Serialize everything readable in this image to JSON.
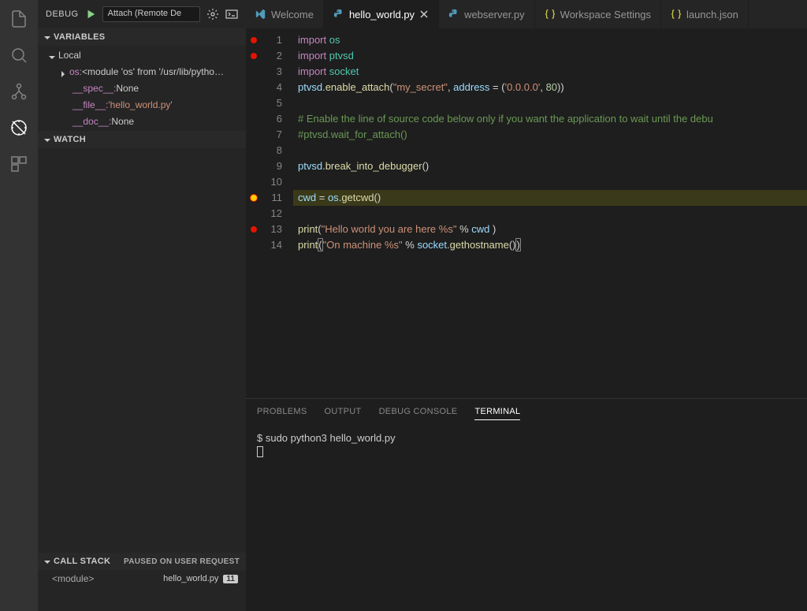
{
  "activity": {
    "icons": [
      "files",
      "search",
      "git",
      "debug",
      "extensions"
    ]
  },
  "debug": {
    "label": "DEBUG",
    "config": "Attach (Remote De",
    "sections": {
      "variables": "VARIABLES",
      "watch": "WATCH",
      "callstack": "CALL STACK"
    },
    "local_label": "Local",
    "vars": [
      {
        "twisty": true,
        "name": "os:",
        "val": " <module 'os' from '/usr/lib/pytho…"
      },
      {
        "name": "__spec__:",
        "val": " None",
        "indent": 2
      },
      {
        "name": "__file__:",
        "val": " 'hello_world.py'",
        "str": true,
        "indent": 2
      },
      {
        "name": "__doc__:",
        "val": " None",
        "indent": 2
      }
    ],
    "callstack_status": "PAUSED ON USER REQUEST",
    "frame": {
      "name": "<module>",
      "file": "hello_world.py",
      "line": "11"
    }
  },
  "tabs": [
    {
      "icon": "vscode",
      "label": "Welcome"
    },
    {
      "icon": "python",
      "label": "hello_world.py",
      "active": true,
      "closable": true
    },
    {
      "icon": "python",
      "label": "webserver.py"
    },
    {
      "icon": "json",
      "label": "Workspace Settings"
    },
    {
      "icon": "json",
      "label": "launch.json"
    }
  ],
  "code": {
    "lines": [
      {
        "n": 1,
        "bp": true,
        "t": [
          [
            "kw",
            "import"
          ],
          [
            "wh",
            " "
          ],
          [
            "mod",
            "os"
          ]
        ]
      },
      {
        "n": 2,
        "bp": true,
        "t": [
          [
            "kw",
            "import"
          ],
          [
            "wh",
            " "
          ],
          [
            "mod",
            "ptvsd"
          ]
        ]
      },
      {
        "n": 3,
        "t": [
          [
            "kw",
            "import"
          ],
          [
            "wh",
            " "
          ],
          [
            "mod",
            "socket"
          ]
        ]
      },
      {
        "n": 4,
        "t": [
          [
            "id",
            "ptvsd"
          ],
          [
            "wh",
            "."
          ],
          [
            "fn",
            "enable_attach"
          ],
          [
            "wh",
            "("
          ],
          [
            "str",
            "\"my_secret\""
          ],
          [
            "wh",
            ", "
          ],
          [
            "id",
            "address"
          ],
          [
            "op",
            " = "
          ],
          [
            "wh",
            "("
          ],
          [
            "str",
            "'0.0.0.0'"
          ],
          [
            "wh",
            ", "
          ],
          [
            "num",
            "80"
          ],
          [
            "wh",
            "))"
          ]
        ]
      },
      {
        "n": 5,
        "t": []
      },
      {
        "n": 6,
        "t": [
          [
            "cmt",
            "# Enable the line of source code below only if you want the application to wait until the debu"
          ]
        ]
      },
      {
        "n": 7,
        "t": [
          [
            "cmt",
            "#ptvsd.wait_for_attach()"
          ]
        ]
      },
      {
        "n": 8,
        "t": []
      },
      {
        "n": 9,
        "t": [
          [
            "id",
            "ptvsd"
          ],
          [
            "wh",
            "."
          ],
          [
            "fn",
            "break_into_debugger"
          ],
          [
            "wh",
            "()"
          ]
        ]
      },
      {
        "n": 10,
        "t": []
      },
      {
        "n": 11,
        "bp": "current",
        "hl": true,
        "t": [
          [
            "id",
            "cwd"
          ],
          [
            "op",
            " = "
          ],
          [
            "id",
            "os"
          ],
          [
            "wh",
            "."
          ],
          [
            "fn",
            "getcwd"
          ],
          [
            "wh",
            "()"
          ]
        ]
      },
      {
        "n": 12,
        "t": []
      },
      {
        "n": 13,
        "bp": true,
        "t": [
          [
            "fn",
            "print"
          ],
          [
            "wh",
            "("
          ],
          [
            "str",
            "\"Hello world you are here %s\""
          ],
          [
            "op",
            " % "
          ],
          [
            "id",
            "cwd"
          ],
          [
            "wh",
            " )"
          ]
        ]
      },
      {
        "n": 14,
        "t": [
          [
            "fn",
            "print"
          ],
          [
            "paren",
            "("
          ],
          [
            "str",
            "\"On machine %s\""
          ],
          [
            "op",
            " % "
          ],
          [
            "id",
            "socket"
          ],
          [
            "wh",
            "."
          ],
          [
            "fn",
            "gethostname"
          ],
          [
            "wh",
            "()"
          ],
          [
            "paren",
            ")"
          ]
        ]
      }
    ]
  },
  "panel": {
    "tabs": [
      "PROBLEMS",
      "OUTPUT",
      "DEBUG CONSOLE",
      "TERMINAL"
    ],
    "active": "TERMINAL",
    "terminal": [
      "$ sudo python3 hello_world.py"
    ]
  }
}
